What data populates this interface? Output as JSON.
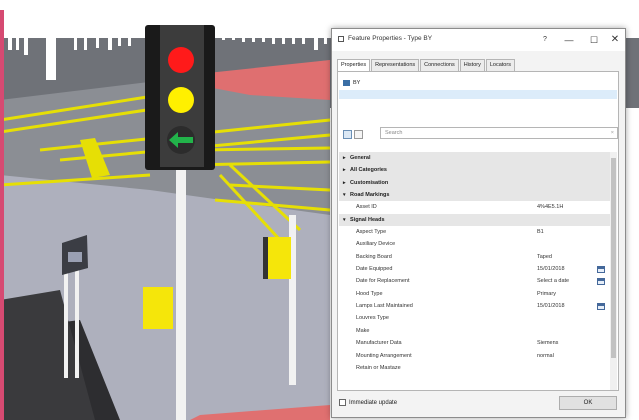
{
  "window": {
    "title": "Feature Properties - Type BY",
    "help": "?",
    "minimize": "—",
    "maximize": "☐",
    "close": "✕"
  },
  "tabs": [
    {
      "label": "Properties",
      "active": true
    },
    {
      "label": "Representations",
      "active": false
    },
    {
      "label": "Connections",
      "active": false
    },
    {
      "label": "History",
      "active": false
    },
    {
      "label": "Locators",
      "active": false
    }
  ],
  "toolbar": {
    "label": "BY"
  },
  "search": {
    "placeholder": "Search"
  },
  "grid": {
    "rows": [
      {
        "type": "category",
        "expander": "▸",
        "label": "General"
      },
      {
        "type": "category",
        "expander": "▸",
        "label": "All Categories"
      },
      {
        "type": "category",
        "expander": "▸",
        "label": "Customisation"
      },
      {
        "type": "category",
        "expander": "▾",
        "label": "Road Markings"
      },
      {
        "type": "property",
        "label": "Asset ID",
        "value": "4%4E5.1H"
      },
      {
        "type": "category",
        "expander": "▾",
        "label": "Signal Heads"
      },
      {
        "type": "property",
        "label": "Aspect Type",
        "value": "B1"
      },
      {
        "type": "property",
        "label": "Auxiliary Device",
        "value": ""
      },
      {
        "type": "property",
        "label": "Backing Board",
        "value": "Taped"
      },
      {
        "type": "property",
        "label": "Date Equipped",
        "value": "15/01/2018",
        "calendar": true
      },
      {
        "type": "property",
        "label": "Date for Replacement",
        "value": "Select a date",
        "calendar": true
      },
      {
        "type": "property",
        "label": "Hood Type",
        "value": "Primary"
      },
      {
        "type": "property",
        "label": "Lamps Last Maintained",
        "value": "15/01/2018",
        "calendar": true
      },
      {
        "type": "property",
        "label": "Louvres Type",
        "value": ""
      },
      {
        "type": "property",
        "label": "Make",
        "value": ""
      },
      {
        "type": "property",
        "label": "Manufacturer Data",
        "value": "Siemens"
      },
      {
        "type": "property",
        "label": "Mounting Arrangement",
        "value": "normal"
      },
      {
        "type": "property",
        "label": "Retain or Mastaze",
        "value": ""
      }
    ]
  },
  "footer": {
    "immediate_update_label": "Immediate update",
    "immediate_update_checked": false,
    "ok_label": "OK"
  },
  "scene": {
    "traffic_light": {
      "lamps": [
        "red",
        "amber",
        "green-arrow"
      ]
    },
    "colors": {
      "sky": "#ffffff",
      "road": "#a9abb6",
      "marking": "#e8e000",
      "building": "#7c7c7c",
      "pink_area": "#e07070"
    }
  }
}
